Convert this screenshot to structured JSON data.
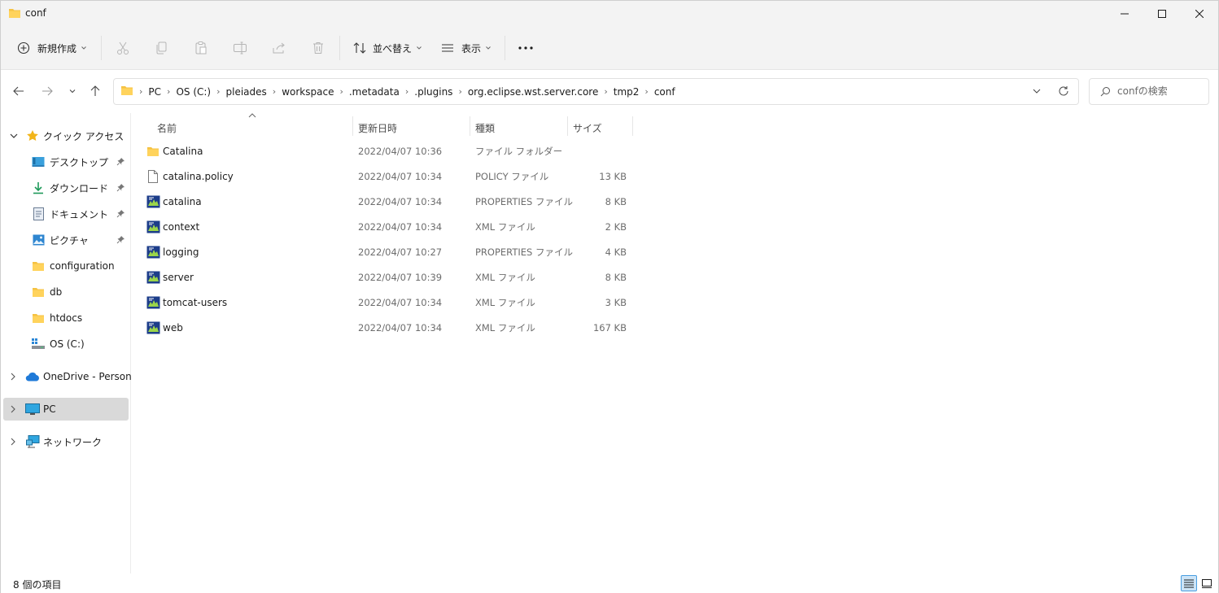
{
  "window": {
    "title": "conf"
  },
  "toolbar": {
    "new_label": "新規作成",
    "sort_label": "並べ替え",
    "view_label": "表示",
    "more_label": "..."
  },
  "address": {
    "crumbs": [
      "PC",
      "OS (C:)",
      "pleiades",
      "workspace",
      ".metadata",
      ".plugins",
      "org.eclipse.wst.server.core",
      "tmp2",
      "conf"
    ]
  },
  "search": {
    "placeholder": "confの検索"
  },
  "sidebar": {
    "quick_access": "クイック アクセス",
    "items": [
      {
        "label": "デスクトップ",
        "icon": "desktop-icon"
      },
      {
        "label": "ダウンロード",
        "icon": "download-icon"
      },
      {
        "label": "ドキュメント",
        "icon": "document-icon"
      },
      {
        "label": "ピクチャ",
        "icon": "picture-icon"
      },
      {
        "label": "configuration",
        "icon": "folder-icon"
      },
      {
        "label": "db",
        "icon": "folder-icon"
      },
      {
        "label": "htdocs",
        "icon": "folder-icon"
      },
      {
        "label": "OS (C:)",
        "icon": "drive-icon"
      }
    ],
    "onedrive": "OneDrive - Personal",
    "pc": "PC",
    "network": "ネットワーク"
  },
  "columns": {
    "name": "名前",
    "date": "更新日時",
    "type": "種類",
    "size": "サイズ"
  },
  "files": [
    {
      "name": "Catalina",
      "date": "2022/04/07 10:36",
      "type": "ファイル フォルダー",
      "size": "",
      "icon": "folder-icon"
    },
    {
      "name": "catalina.policy",
      "date": "2022/04/07 10:34",
      "type": "POLICY ファイル",
      "size": "13 KB",
      "icon": "file-icon"
    },
    {
      "name": "catalina",
      "date": "2022/04/07 10:34",
      "type": "PROPERTIES ファイル",
      "size": "8 KB",
      "icon": "config-file-icon"
    },
    {
      "name": "context",
      "date": "2022/04/07 10:34",
      "type": "XML ファイル",
      "size": "2 KB",
      "icon": "config-file-icon"
    },
    {
      "name": "logging",
      "date": "2022/04/07 10:27",
      "type": "PROPERTIES ファイル",
      "size": "4 KB",
      "icon": "config-file-icon"
    },
    {
      "name": "server",
      "date": "2022/04/07 10:39",
      "type": "XML ファイル",
      "size": "8 KB",
      "icon": "config-file-icon"
    },
    {
      "name": "tomcat-users",
      "date": "2022/04/07 10:34",
      "type": "XML ファイル",
      "size": "3 KB",
      "icon": "config-file-icon"
    },
    {
      "name": "web",
      "date": "2022/04/07 10:34",
      "type": "XML ファイル",
      "size": "167 KB",
      "icon": "config-file-icon"
    }
  ],
  "status": {
    "item_count": "8 個の項目"
  },
  "colors": {
    "folder": "#f5c242",
    "selected": "#d9d9d9",
    "accent": "#0a64c8"
  }
}
